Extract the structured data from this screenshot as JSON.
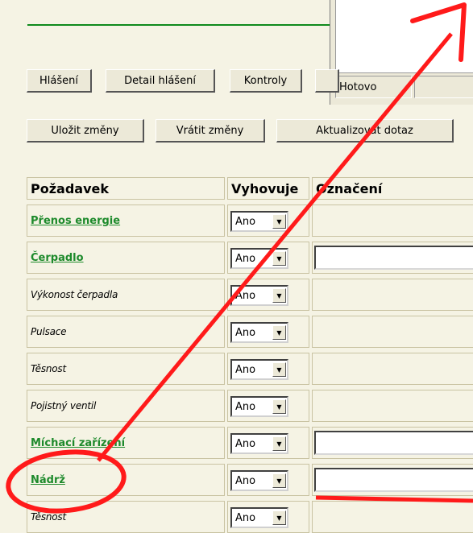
{
  "popup": {
    "status": "Hotovo"
  },
  "tabs": [
    {
      "label": "Hlášení"
    },
    {
      "label": "Detail hlášení"
    },
    {
      "label": "Kontroly"
    }
  ],
  "actions": {
    "save": "Uložit změny",
    "revert": "Vrátit změny",
    "refresh": "Aktualizovat dotaz"
  },
  "table": {
    "headers": {
      "requirement": "Požadavek",
      "complies": "Vyhovuje",
      "marking": "Označení"
    },
    "rows": [
      {
        "label": "Přenos energie",
        "style": "link",
        "value": "Ano",
        "has_text_input": false
      },
      {
        "label": "Čerpadlo",
        "style": "link",
        "value": "Ano",
        "has_text_input": true
      },
      {
        "label": "Výkonost čerpadla",
        "style": "italic",
        "value": "Ano",
        "has_text_input": false
      },
      {
        "label": "Pulsace",
        "style": "italic",
        "value": "Ano",
        "has_text_input": false
      },
      {
        "label": "Těsnost",
        "style": "italic",
        "value": "Ano",
        "has_text_input": false
      },
      {
        "label": "Pojistný ventil",
        "style": "italic",
        "value": "Ano",
        "has_text_input": false
      },
      {
        "label": "Míchací zařízení",
        "style": "link",
        "value": "Ano",
        "has_text_input": true
      },
      {
        "label": "Nádrž",
        "style": "link",
        "value": "Ano",
        "has_text_input": true
      },
      {
        "label": "Těsnost",
        "style": "italic",
        "value": "Ano",
        "has_text_input": false
      }
    ]
  },
  "colors": {
    "background": "#f5f3e4",
    "link": "#1d8a2b",
    "annotation": "#ff1a1a"
  }
}
